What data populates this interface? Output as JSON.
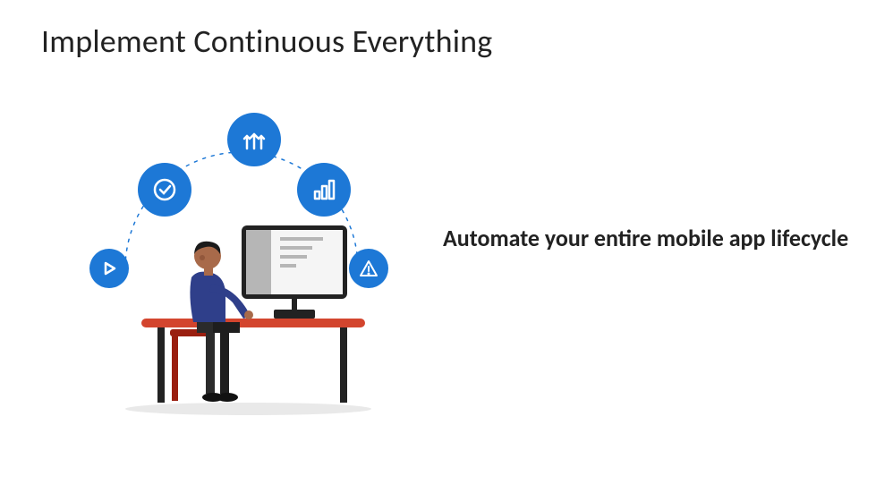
{
  "title": "Implement Continuous Everything",
  "subhead": "Automate your entire mobile app lifecycle",
  "icons": {
    "top": "branch-arrows-icon",
    "chart": "bar-chart-icon",
    "check": "checkmark-circle-icon",
    "play": "play-icon",
    "warn": "warning-icon"
  },
  "colors": {
    "icon_bg": "#1d78d6",
    "desk": "#d3452e",
    "hair": "#1b1b1b",
    "skin": "#a86a4a",
    "shirt": "#2f3f8a",
    "pants": "#2b2b2b"
  }
}
